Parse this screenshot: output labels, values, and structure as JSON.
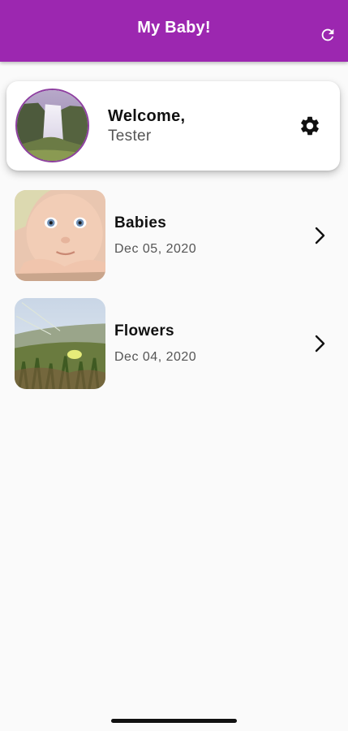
{
  "app_bar": {
    "title": "My Baby!",
    "background_color": "#9c27b0",
    "refresh_icon": "refresh-icon"
  },
  "welcome_card": {
    "greeting": "Welcome,",
    "user_name": "Tester",
    "settings_icon": "gear-icon"
  },
  "albums": [
    {
      "title": "Babies",
      "date": "Dec 05, 2020",
      "chevron_icon": "chevron-right-icon"
    },
    {
      "title": "Flowers",
      "date": "Dec 04, 2020",
      "chevron_icon": "chevron-right-icon"
    }
  ]
}
